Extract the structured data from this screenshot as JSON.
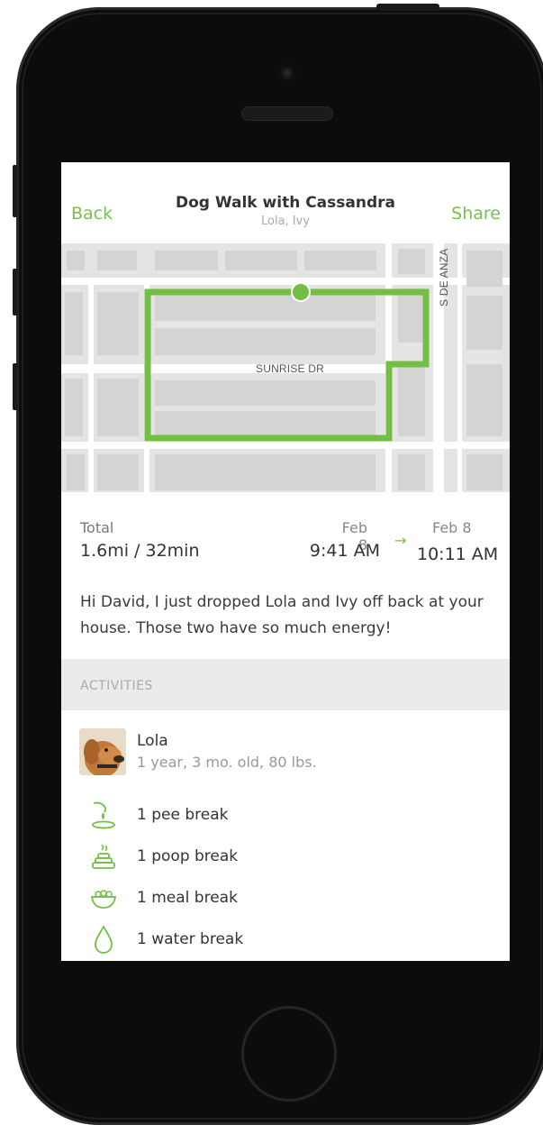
{
  "nav": {
    "back_label": "Back",
    "title": "Dog Walk with Cassandra",
    "subtitle": "Lola, Ivy",
    "share_label": "Share"
  },
  "map": {
    "street_labels": [
      "SUNRISE DR",
      "S DE ANZA"
    ],
    "route_color": "#72bf44"
  },
  "walk": {
    "total_label": "Total",
    "total_value": "1.6mi / 32min",
    "start_date": "Feb 8",
    "start_time": "9:41 AM",
    "arrow": "→",
    "end_date": "Feb 8",
    "end_time": "10:11 AM",
    "message": "Hi David, I just dropped Lola and Ivy off back at your house. Those two have so much energy!"
  },
  "activities": {
    "header": "ACTIVITIES",
    "dog": {
      "name": "Lola",
      "info": "1 year, 3 mo. old, 80 lbs."
    },
    "items": [
      {
        "icon": "pee-icon",
        "label": "1 pee break"
      },
      {
        "icon": "poop-icon",
        "label": "1 poop break"
      },
      {
        "icon": "meal-bowl-icon",
        "label": "1 meal break"
      },
      {
        "icon": "water-drop-icon",
        "label": "1 water break"
      }
    ]
  },
  "colors": {
    "accent": "#7bbf4c",
    "section_bg": "#e9ebec"
  }
}
